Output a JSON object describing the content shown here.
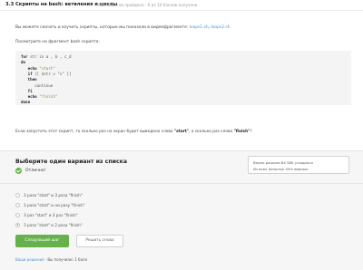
{
  "header": {
    "step_title": "3.3 Скрипты на bash: ветвления и циклы",
    "step_meta": "6 из 6 шагов пройдено · 6 из 10 баллов получено"
  },
  "intro": {
    "text": "Вы можете скачать и изучить скрипты, которые мы показали в видеофрагменте:",
    "link1": "loops1.sh",
    "link2": "loops2.sh",
    "script_lead": "Посмотрите на фрагмент bash скрипта:"
  },
  "code": {
    "line1_kw": "for",
    "line1_rest": " str in a , b , c_d",
    "line2": "do",
    "line3_kw": "echo",
    "line3_str": "\"start\"",
    "line4_kw": "if",
    "line4_rest": " [[ $str > \"c\" ]]",
    "line5": "then",
    "line6": "continue",
    "line7": "fi",
    "line8_kw": "echo",
    "line8_str": "\"finish\"",
    "line9": "done"
  },
  "question": {
    "part1": "Если запустить этот скрипт, то сколько раз на экран будет выведено слово ",
    "start": "\"start\"",
    "part2": ", а сколько раз слово ",
    "finish": "\"finish\"",
    "part3": "?"
  },
  "answer": {
    "choose_title": "Выберите один вариант из списка",
    "correct_label": "Отлично!",
    "stats_line1": "Верно решили 84 580 учащихся",
    "stats_line2": "Из всех попыток 45% верных"
  },
  "options": [
    {
      "label": "3 раза \"start\" и 3 раза \"finish\"",
      "selected": false
    },
    {
      "label": "3 раза \"start\" и ни разу \"finish\"",
      "selected": false
    },
    {
      "label": "3 раз \"start\" и 3 раз \"finish\"",
      "selected": false
    },
    {
      "label": "3 раза \"start\" и 2 раза \"finish\"",
      "selected": true
    }
  ],
  "buttons": {
    "next": "Следующий шаг",
    "retry": "Решить снова"
  },
  "footer": {
    "link": "Ваши решения",
    "separator": "·",
    "earned": "Вы получили: 1 балл"
  },
  "colors": {
    "accent_green": "#66b14c",
    "link_blue": "#4a90d9"
  }
}
